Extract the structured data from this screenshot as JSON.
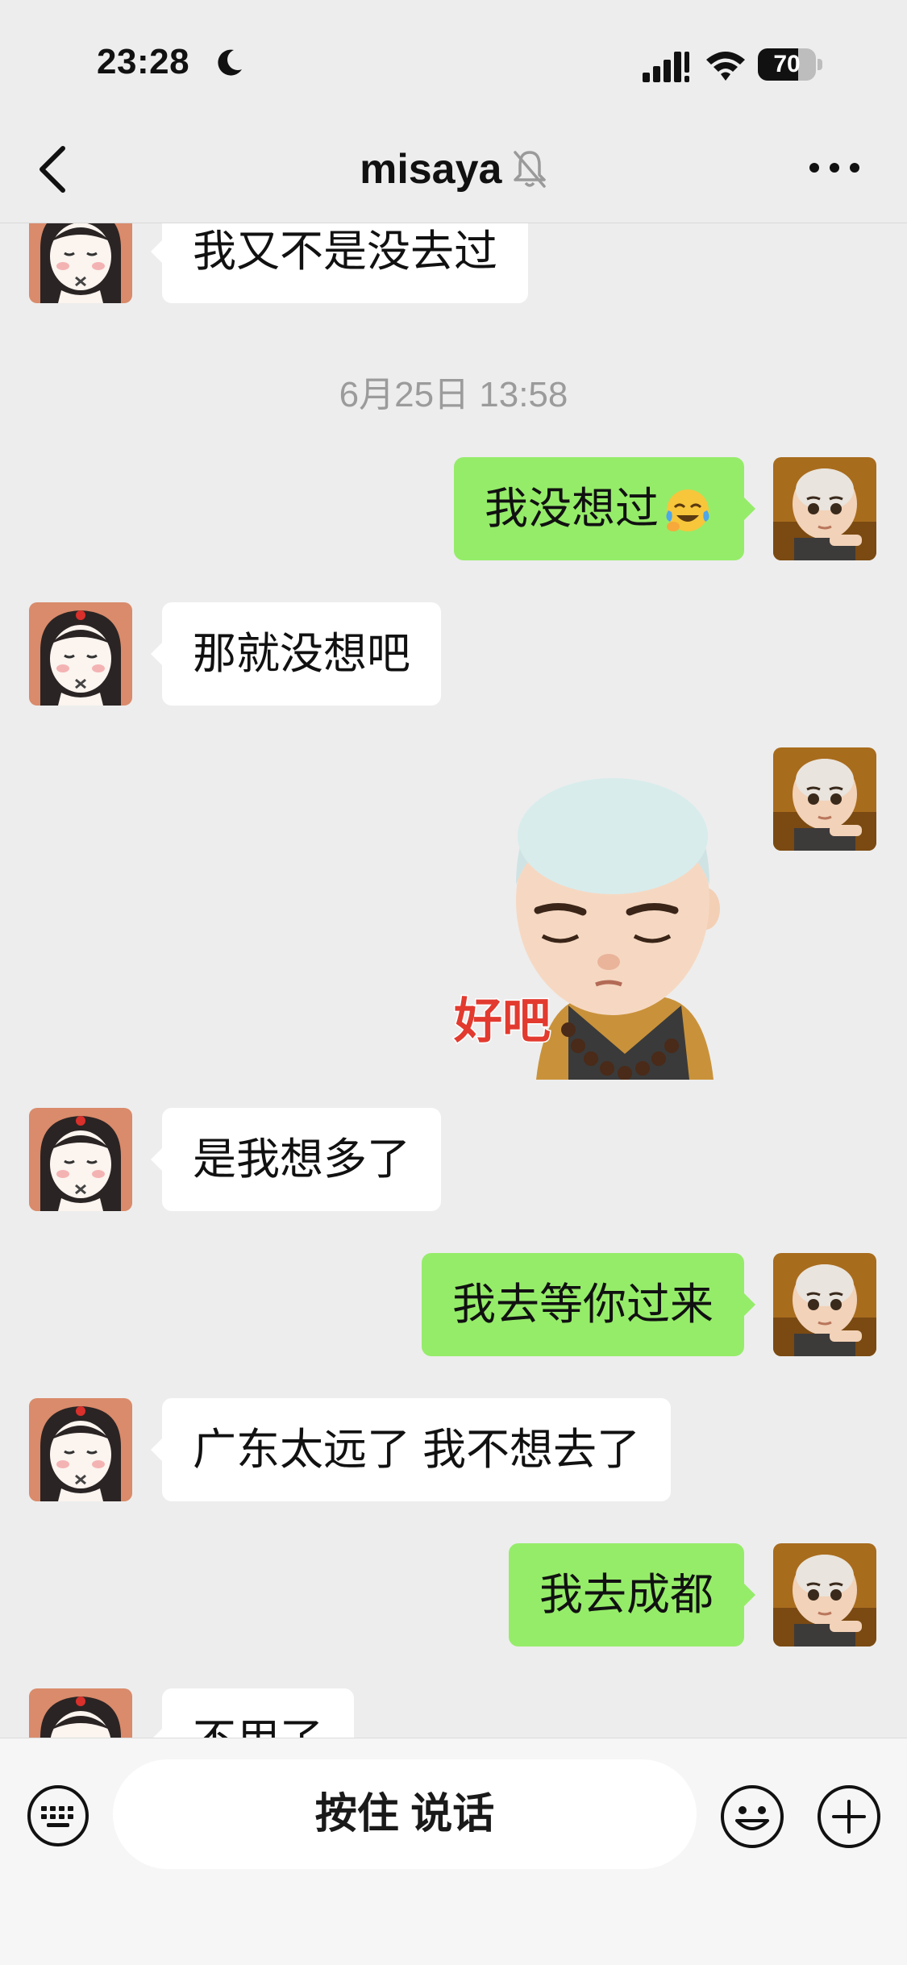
{
  "status_bar": {
    "time": "23:28",
    "battery_percent": "70",
    "battery_level": 0.7
  },
  "nav": {
    "title": "misaya"
  },
  "messages": [
    {
      "side": "in",
      "text": "我又不是没去过"
    },
    {
      "timestamp": "6月25日 13:58"
    },
    {
      "side": "out",
      "text": "我没想过",
      "emoji": "crying-laughing-emoji"
    },
    {
      "side": "in",
      "text": "那就没想吧"
    },
    {
      "side": "out",
      "sticker_text": "好吧"
    },
    {
      "side": "in",
      "text": "是我想多了"
    },
    {
      "side": "out",
      "text": "我去等你过来"
    },
    {
      "side": "in",
      "text": "广东太远了 我不想去了"
    },
    {
      "side": "out",
      "text": "我去成都"
    },
    {
      "side": "in",
      "text": "不用了"
    }
  ],
  "input_bar": {
    "hold_to_talk": "按住 说话"
  },
  "colors": {
    "background": "#ededed",
    "outgoing_bubble": "#95ec69",
    "incoming_bubble": "#ffffff",
    "timestamp": "#9b9b9b"
  }
}
